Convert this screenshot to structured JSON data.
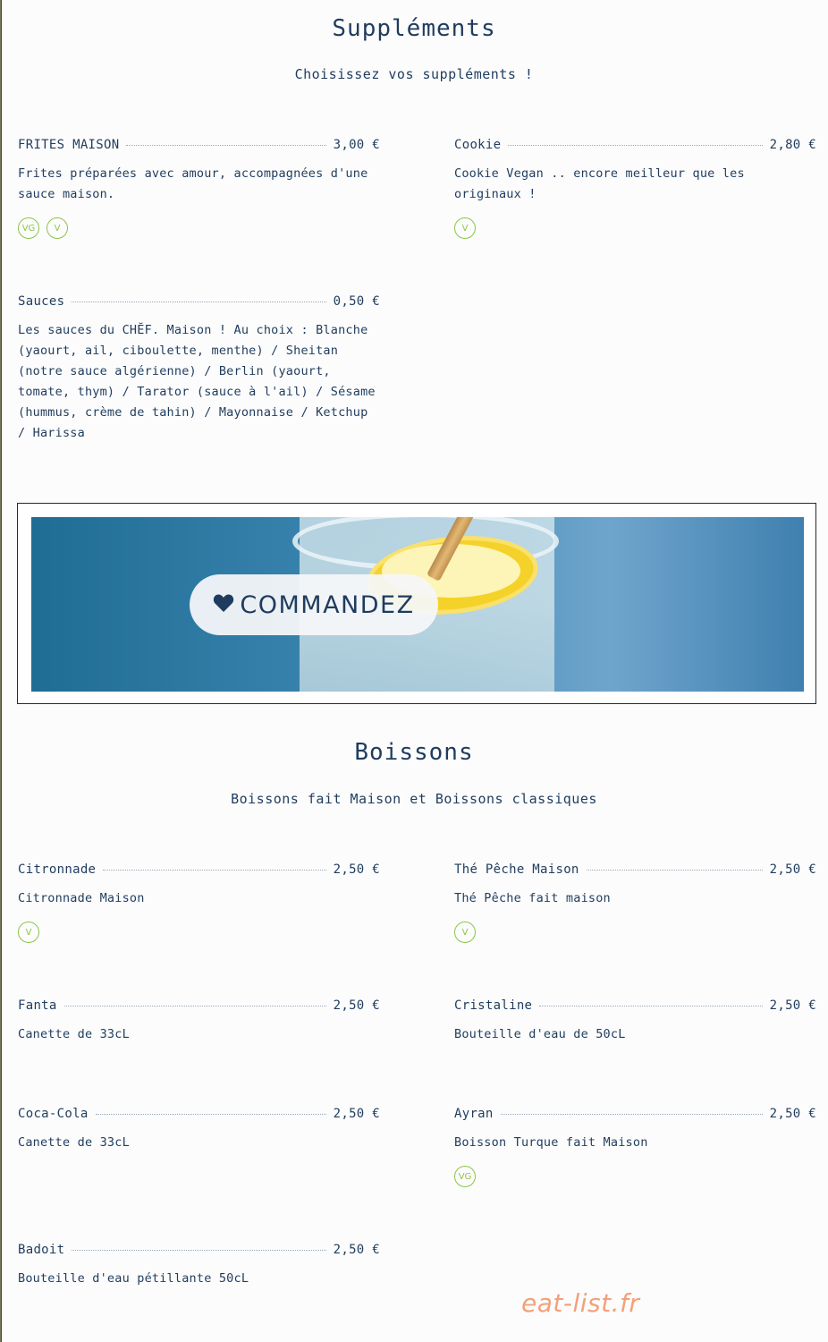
{
  "supplements": {
    "title": "Suppléments",
    "subtitle": "Choisissez vos suppléments !",
    "items": [
      {
        "name": "FRITES MAISON",
        "price": "3,00 €",
        "description": "Frites préparées avec amour, accompagnées d'une sauce maison.",
        "badges": [
          "VG",
          "V"
        ]
      },
      {
        "name": "Cookie",
        "price": "2,80 €",
        "description": "Cookie Vegan .. encore meilleur que les originaux !",
        "badges": [
          "V"
        ]
      },
      {
        "name": "Sauces",
        "price": "0,50 €",
        "description": "Les sauces du CHĔF. Maison ! Au choix : Blanche (yaourt, ail, ciboulette, menthe) / Sheitan (notre sauce algérienne) / Berlin (yaourt, tomate, thym) / Tarator (sauce à l'ail) / Sésame (hummus, crème de tahin) / Mayonnaise / Ketchup / Harissa",
        "badges": []
      }
    ]
  },
  "banner": {
    "cta_label": "COMMANDEZ",
    "icon": "heart-icon"
  },
  "boissons": {
    "title": "Boissons",
    "subtitle": "Boissons fait Maison et Boissons classiques",
    "items": [
      {
        "name": "Citronnade",
        "price": "2,50 €",
        "description": "Citronnade Maison",
        "badges": [
          "V"
        ]
      },
      {
        "name": "Thé Pêche Maison",
        "price": "2,50 €",
        "description": "Thé Pêche fait maison",
        "badges": [
          "V"
        ]
      },
      {
        "name": "Fanta",
        "price": "2,50 €",
        "description": "Canette de 33cL",
        "badges": []
      },
      {
        "name": "Cristaline",
        "price": "2,50 €",
        "description": "Bouteille d'eau de 50cL",
        "badges": []
      },
      {
        "name": "Coca-Cola",
        "price": "2,50 €",
        "description": "Canette de 33cL",
        "badges": []
      },
      {
        "name": "Ayran",
        "price": "2,50 €",
        "description": "Boisson Turque fait Maison",
        "badges": [
          "VG"
        ]
      },
      {
        "name": "Badoit",
        "price": "2,50 €",
        "description": "Bouteille d'eau pétillante 50cL",
        "badges": []
      }
    ]
  },
  "watermark": "eat-list.fr",
  "colors": {
    "primary": "#1f3c5e",
    "badge": "#8cc44a",
    "watermark": "#f4a079"
  }
}
